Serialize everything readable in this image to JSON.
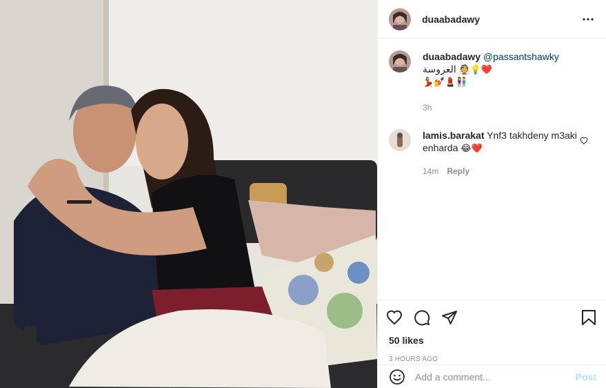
{
  "post": {
    "author": "duaabadawy",
    "image_alt": "Two women hugging on a black couch",
    "likes": "50 likes",
    "time": "3 HOURS AGO"
  },
  "caption": {
    "username": "duaabadawy",
    "mention": "@passantshawky",
    "text": "العروسة",
    "emoji_line1": "👰💡❤️",
    "emoji_line2": "💃💅💄👫",
    "age": "3h"
  },
  "comments": [
    {
      "username": "lamis.barakat",
      "text": "Ynf3 takhdeny m3aki enharda",
      "emoji": "😂❤️",
      "age": "14m",
      "reply_label": "Reply"
    }
  ],
  "add_comment": {
    "placeholder": "Add a comment...",
    "post_label": "Post"
  },
  "icons": {
    "more": "more-options-icon",
    "like": "heart-icon",
    "comment": "comment-bubble-icon",
    "share": "paper-plane-icon",
    "save": "bookmark-icon",
    "emoji": "smiley-icon"
  },
  "colors": {
    "link": "#00376b",
    "muted": "#8e8e8e",
    "post_button": "#b2dffc",
    "heart_red": "#ed4956"
  }
}
